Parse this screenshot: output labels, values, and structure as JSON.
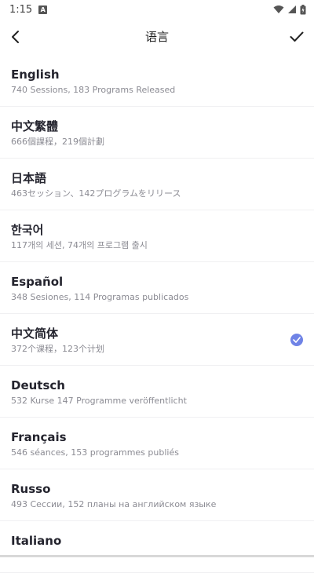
{
  "status": {
    "time": "1:15",
    "notif_icon_letter": "A"
  },
  "appbar": {
    "title": "语言"
  },
  "colors": {
    "accent": "#6f83e6"
  },
  "languages": [
    {
      "name": "English",
      "sub": "740 Sessions, 183 Programs Released",
      "selected": false
    },
    {
      "name": "中文繁體",
      "sub": "666個課程，219個計劃",
      "selected": false
    },
    {
      "name": "日本語",
      "sub": "463セッション、142プログラムをリリース",
      "selected": false
    },
    {
      "name": "한국어",
      "sub": "117개의 세션, 74개의 프로그램 출시",
      "selected": false
    },
    {
      "name": "Español",
      "sub": "348 Sesiones, 114 Programas publicados",
      "selected": false
    },
    {
      "name": "中文简体",
      "sub": "372个课程，123个计划",
      "selected": true
    },
    {
      "name": "Deutsch",
      "sub": "532 Kurse 147 Programme veröffentlicht",
      "selected": false
    },
    {
      "name": "Français",
      "sub": "546 séances, 153 programmes publiés",
      "selected": false
    },
    {
      "name": "Russo",
      "sub": "493 Сессии, 152 планы на английском языке",
      "selected": false
    },
    {
      "name": "Italiano",
      "sub": "",
      "selected": false
    }
  ]
}
